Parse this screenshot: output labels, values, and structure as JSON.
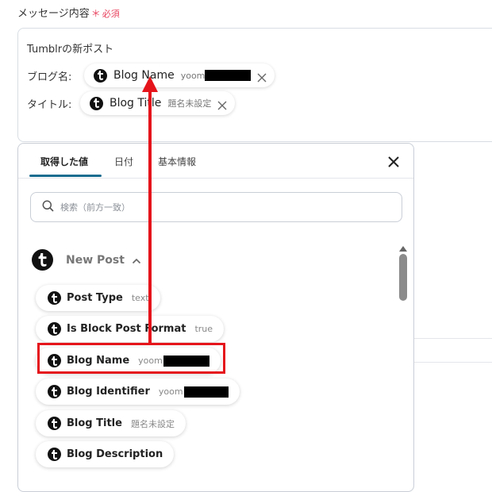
{
  "field": {
    "label": "メッセージ内容",
    "required_mark": "＊",
    "required_text": "必須"
  },
  "message": {
    "line1": "Tumblrの新ポスト",
    "blog_name_label": "ブログ名:",
    "title_label": "タイトル:"
  },
  "message_pills": [
    {
      "name": "Blog Name",
      "value": "yoom"
    },
    {
      "name": "Blog Title",
      "value": "題名未設定"
    }
  ],
  "dropdown": {
    "tabs": [
      "取得した値",
      "日付",
      "基本情報"
    ],
    "active_tab": 0,
    "search_placeholder": "検索（前方一致）",
    "group_title": "New Post",
    "options": [
      {
        "name": "Post Type",
        "value": "text"
      },
      {
        "name": "Is Block Post Format",
        "value": "true"
      },
      {
        "name": "Blog Name",
        "value": "yoom"
      },
      {
        "name": "Blog Identifier",
        "value": "yoom"
      },
      {
        "name": "Blog Title",
        "value": "題名未設定"
      },
      {
        "name": "Blog Description",
        "value": ""
      }
    ]
  },
  "colors": {
    "accent": "#1a6c8f",
    "required": "#e8425e",
    "annotation": "#e5141b"
  },
  "icons": {
    "tumblr": "tumblr-icon",
    "remove": "close-icon",
    "search": "search-icon",
    "collapse": "chevron-up-icon"
  }
}
